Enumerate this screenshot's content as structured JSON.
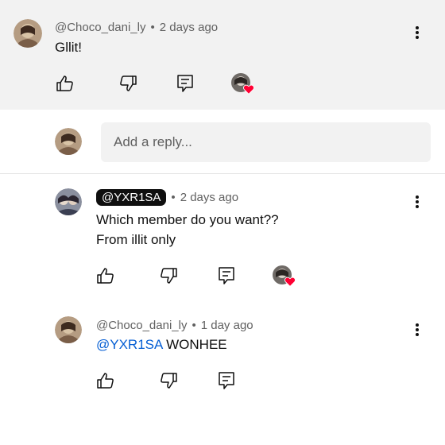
{
  "comments": [
    {
      "author": "@Choco_dani_ly",
      "separator": "•",
      "time": "2 days ago",
      "lines": [
        "Gllit!"
      ]
    },
    {
      "author": "@YXR1SA",
      "separator": "•",
      "time": "2 days ago",
      "lines": [
        "Which member do you want??",
        "From illit only"
      ]
    },
    {
      "author": "@Choco_dani_ly",
      "separator": "•",
      "time": "1 day ago",
      "mention": "@YXR1SA",
      "text_after_mention": "WONHEE"
    }
  ],
  "reply": {
    "placeholder": "Add a reply..."
  },
  "icons": {
    "like": "thumbs-up-icon",
    "dislike": "thumbs-down-icon",
    "reply": "reply-icon",
    "more": "more-vert-icon",
    "creator_heart": "creator-heart-icon"
  },
  "colors": {
    "band": "#f2f2f2",
    "mention": "#065fd4",
    "heart": "#ff0033",
    "meta": "#606060"
  }
}
